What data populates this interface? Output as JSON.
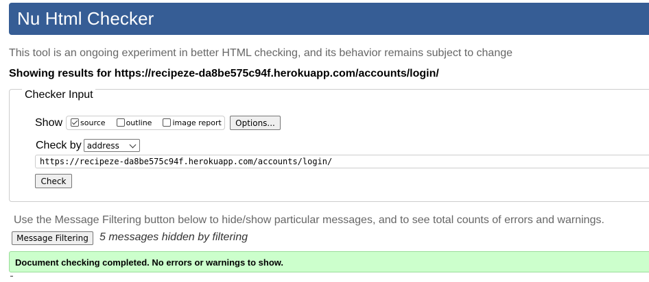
{
  "header": {
    "title": "Nu Html Checker"
  },
  "intro_text": "This tool is an ongoing experiment in better HTML checking, and its behavior remains subject to change",
  "showing": {
    "prefix": "Showing results for ",
    "url": "https://recipeze-da8be575c94f.herokuapp.com/accounts/login/"
  },
  "checker_input": {
    "legend": "Checker Input",
    "show_label": "Show",
    "options": [
      {
        "label": "source",
        "checked": true
      },
      {
        "label": "outline",
        "checked": false
      },
      {
        "label": "image report",
        "checked": false
      }
    ],
    "options_button": "Options...",
    "check_by_label": "Check by",
    "check_by_value": "address",
    "url_value": "https://recipeze-da8be575c94f.herokuapp.com/accounts/login/",
    "check_button": "Check"
  },
  "filtering": {
    "note": "Use the Message Filtering button below to hide/show particular messages, and to see total counts of errors and warnings.",
    "button": "Message Filtering",
    "hidden_count": "5 messages hidden by filtering"
  },
  "result": {
    "message": "Document checking completed. No errors or warnings to show."
  },
  "colors": {
    "header_bg": "#365d95",
    "success_bg": "#ccffcc",
    "muted_text": "#666666"
  }
}
